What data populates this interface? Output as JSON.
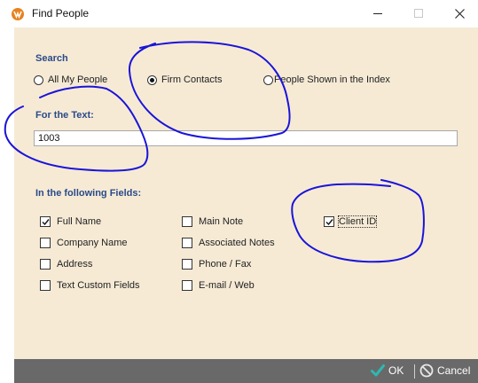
{
  "window": {
    "title": "Find People",
    "buttons": {
      "minimize": "minimize-icon",
      "maximize": "maximize-icon",
      "close": "close-icon"
    }
  },
  "search": {
    "label": "Search",
    "options": [
      {
        "label": "All My People",
        "selected": false
      },
      {
        "label": "Firm Contacts",
        "selected": true
      },
      {
        "label": "People Shown in the Index",
        "selected": false
      }
    ]
  },
  "text": {
    "label": "For the Text:",
    "value": "1003"
  },
  "fields": {
    "label": "In the following Fields:",
    "items": [
      {
        "label": "Full Name",
        "checked": true
      },
      {
        "label": "Company Name",
        "checked": false
      },
      {
        "label": "Address",
        "checked": false
      },
      {
        "label": "Text Custom Fields",
        "checked": false
      },
      {
        "label": "Main Note",
        "checked": false
      },
      {
        "label": "Associated Notes",
        "checked": false
      },
      {
        "label": "Phone / Fax",
        "checked": false
      },
      {
        "label": "E-mail / Web",
        "checked": false
      },
      {
        "label": "Client ID",
        "checked": true
      }
    ]
  },
  "footer": {
    "ok_label": "OK",
    "cancel_label": "Cancel"
  },
  "colors": {
    "panel": "#f6ead5",
    "label_blue": "#2a4a8a",
    "annotation": "#1a14d8",
    "footer": "#696969",
    "ok_check": "#2fb8b0"
  }
}
